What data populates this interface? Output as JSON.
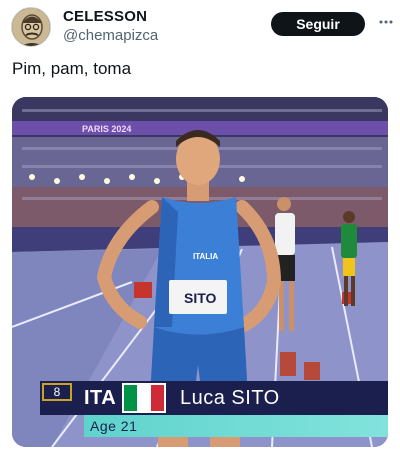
{
  "tweet": {
    "display_name": "CELESSON",
    "handle": "@chemapizca",
    "follow_label": "Seguir",
    "text": "Pim, pam, toma"
  },
  "media": {
    "banner": "PARIS 2024",
    "bib": "SITO",
    "singlet_text": "ITALIA",
    "broadcast": {
      "lane": "8",
      "country": "ITA",
      "name": "Luca SITO",
      "age": "Age 21",
      "flag_colors": [
        "#009246",
        "#ffffff",
        "#ce2b37"
      ]
    }
  },
  "icons": {
    "more": "more-horizontal-icon",
    "avatar": "user-avatar"
  },
  "colors": {
    "follow_bg": "#0f1419",
    "handle": "#536471",
    "track": "#8e93c9",
    "banner": "#6b4fa8",
    "lower_third": "#1b1f4d",
    "lower_third_accent": "#5fd3cc"
  }
}
